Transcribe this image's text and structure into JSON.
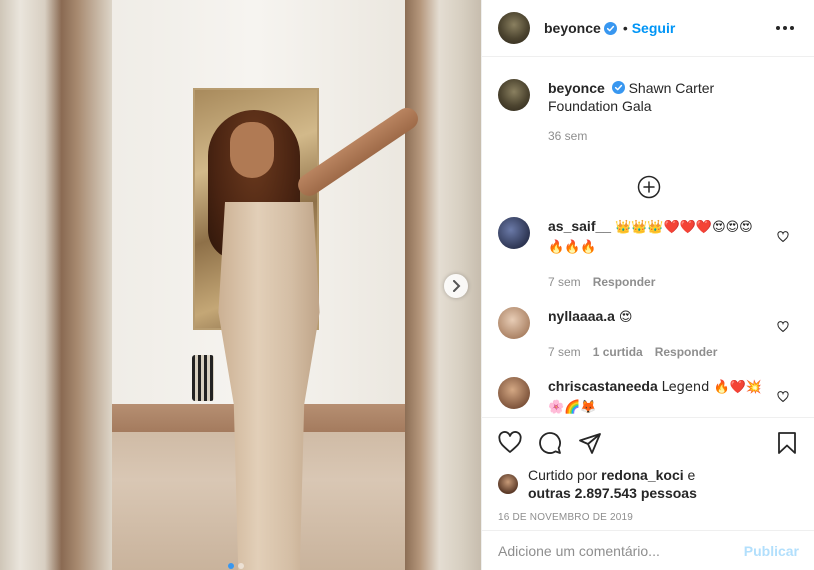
{
  "post": {
    "author": "beyonce",
    "follow_separator": "•",
    "follow_label": "Seguir",
    "caption_text": "Shawn Carter Foundation Gala",
    "caption_time": "36 sem",
    "carousel_index": 1,
    "carousel_count": 2
  },
  "comments": [
    {
      "user": "as_saif__",
      "text": "👑👑👑❤️❤️❤️😍😍😍🔥🔥🔥",
      "time": "7 sem",
      "likes": "",
      "reply": "Responder",
      "avatar_color": "#2d3552"
    },
    {
      "user": "nyllaaaa.a",
      "text": "😍",
      "time": "7 sem",
      "likes": "1 curtida",
      "reply": "Responder",
      "avatar_color": "#c4a58e"
    },
    {
      "user": "chriscastaneeda",
      "text": "Legend 🔥❤️💥🌸🌈🦊",
      "time": "",
      "likes": "",
      "reply": "",
      "avatar_color": "#a07250"
    }
  ],
  "likes": {
    "prefix": "Curtido por",
    "liker": "redona_koci",
    "conj": "e",
    "others": "outras 2.897.543 pessoas"
  },
  "date": "16 DE NOVEMBRO DE 2019",
  "add_comment": {
    "placeholder": "Adicione um comentário...",
    "publish_label": "Publicar"
  },
  "colors": {
    "accent": "#0095f6",
    "verified": "#3897f0",
    "publish_disabled": "#b2dffc",
    "muted": "#8e8e8e"
  },
  "icons": [
    "verified-badge-icon",
    "more-options-icon",
    "load-more-comments-icon",
    "heart-icon",
    "comment-icon",
    "share-icon",
    "save-icon",
    "next-arrow-icon"
  ]
}
